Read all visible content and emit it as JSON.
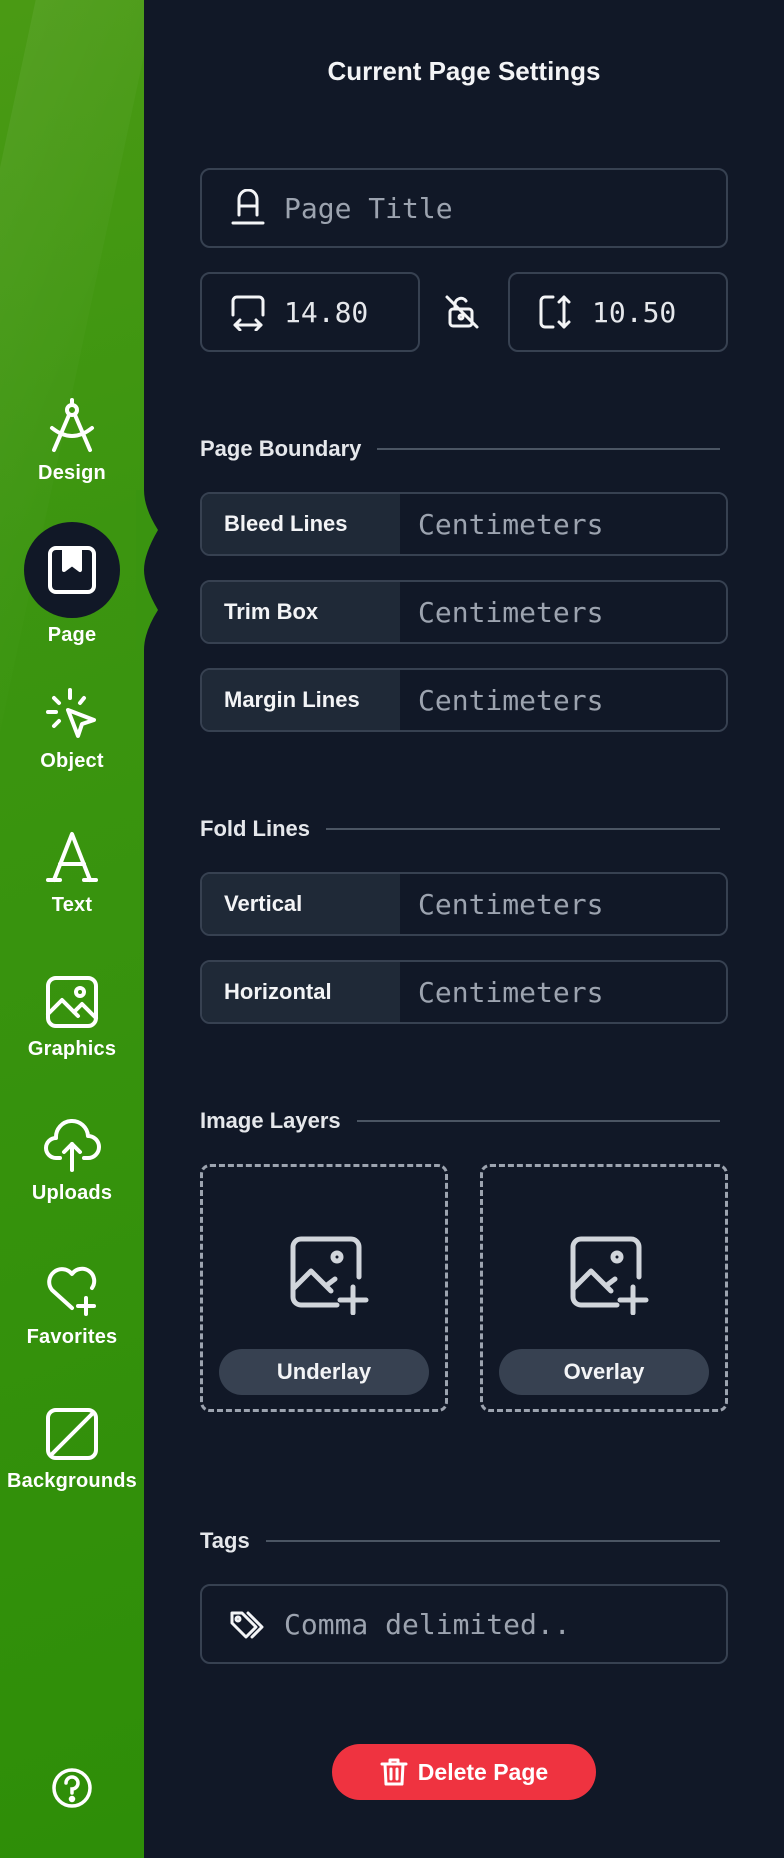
{
  "sidebar": {
    "items": [
      {
        "label": "Design",
        "icon": "compass-icon"
      },
      {
        "label": "Page",
        "icon": "page-icon",
        "active": true
      },
      {
        "label": "Object",
        "icon": "cursor-click-icon"
      },
      {
        "label": "Text",
        "icon": "text-icon"
      },
      {
        "label": "Graphics",
        "icon": "image-icon"
      },
      {
        "label": "Uploads",
        "icon": "cloud-upload-icon"
      },
      {
        "label": "Favorites",
        "icon": "heart-plus-icon"
      },
      {
        "label": "Backgrounds",
        "icon": "background-icon"
      }
    ],
    "help_icon": "help-icon"
  },
  "panel": {
    "title": "Current Page Settings",
    "page_title": {
      "placeholder": "Page Title"
    },
    "width": {
      "value": "14.80"
    },
    "height": {
      "value": "10.50"
    },
    "page_boundary": {
      "title": "Page Boundary",
      "rows": [
        {
          "label": "Bleed Lines",
          "placeholder": "Centimeters"
        },
        {
          "label": "Trim Box",
          "placeholder": "Centimeters"
        },
        {
          "label": "Margin Lines",
          "placeholder": "Centimeters"
        }
      ]
    },
    "fold_lines": {
      "title": "Fold Lines",
      "rows": [
        {
          "label": "Vertical",
          "placeholder": "Centimeters"
        },
        {
          "label": "Horizontal",
          "placeholder": "Centimeters"
        }
      ]
    },
    "image_layers": {
      "title": "Image Layers",
      "underlay_label": "Underlay",
      "overlay_label": "Overlay"
    },
    "tags": {
      "title": "Tags",
      "placeholder": "Comma delimited.."
    },
    "delete_label": "Delete Page"
  },
  "colors": {
    "sidebar_green": "#3c9510",
    "panel_bg": "#111827",
    "danger": "#ef3340"
  }
}
